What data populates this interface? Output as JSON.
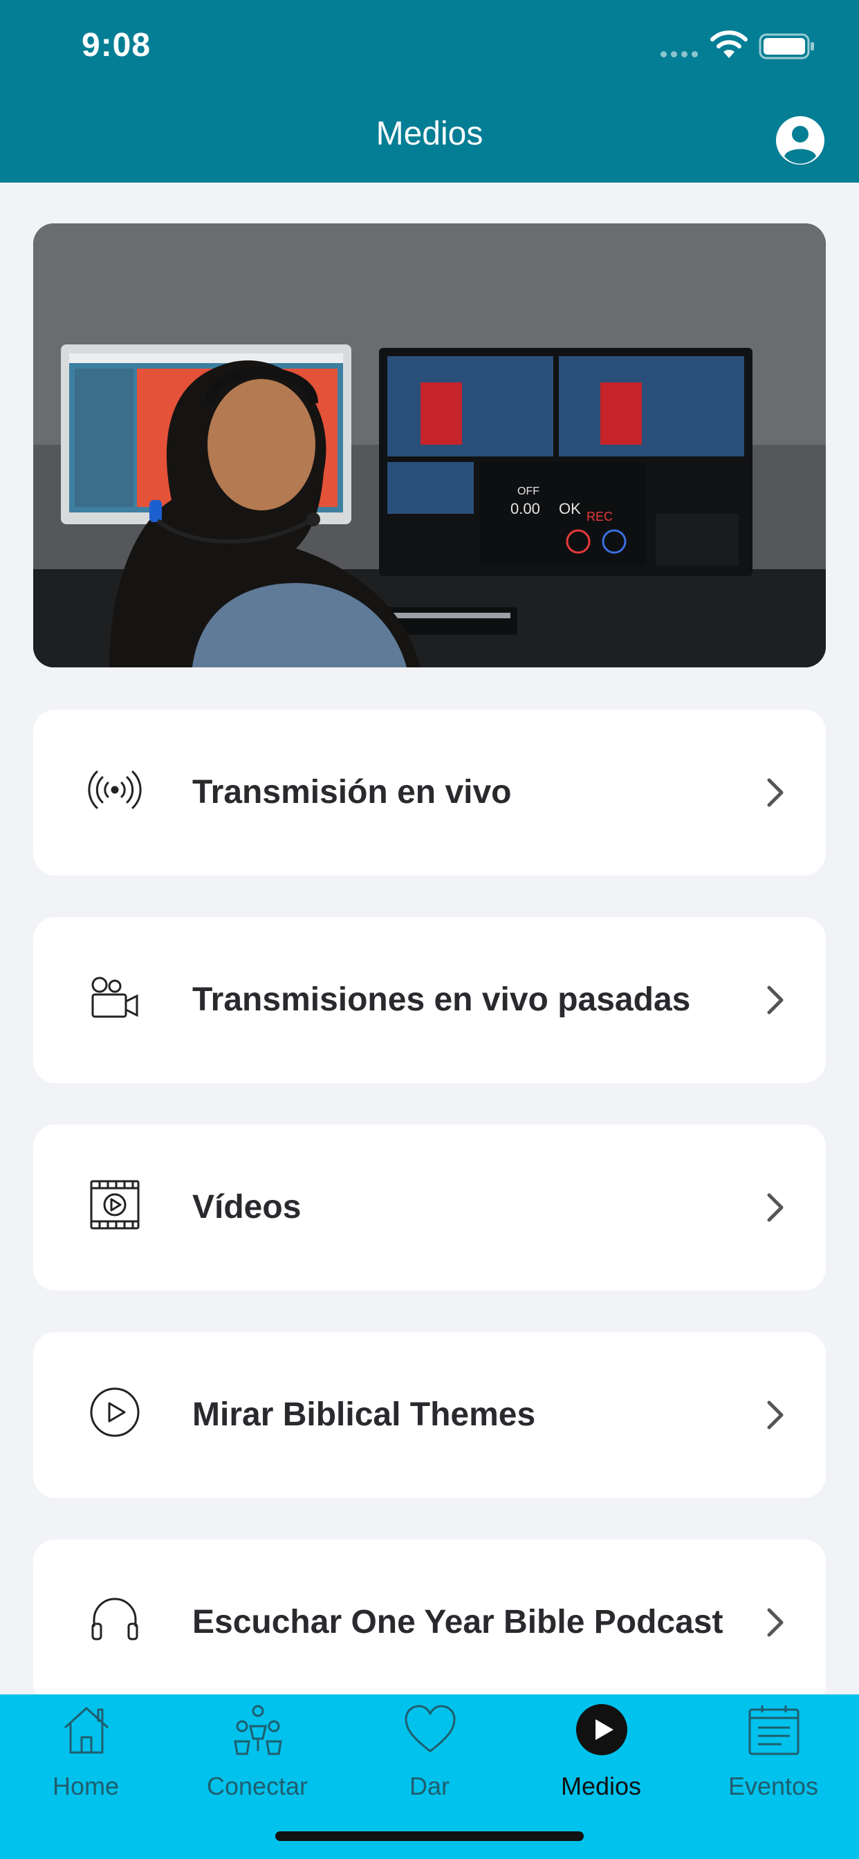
{
  "status_bar": {
    "time": "9:08"
  },
  "header": {
    "title": "Medios"
  },
  "menu": {
    "items": [
      {
        "label": "Transmisión en vivo",
        "icon": "broadcast-icon"
      },
      {
        "label": "Transmisiones en vivo pasadas",
        "icon": "video-camera-icon"
      },
      {
        "label": "Vídeos",
        "icon": "film-play-icon"
      },
      {
        "label": "Mirar Biblical Themes",
        "icon": "play-circle-icon"
      },
      {
        "label": "Escuchar One Year Bible Podcast",
        "icon": "headphones-icon"
      }
    ]
  },
  "tabbar": {
    "tabs": [
      {
        "label": "Home",
        "icon": "home-icon"
      },
      {
        "label": "Conectar",
        "icon": "people-icon"
      },
      {
        "label": "Dar",
        "icon": "heart-icon"
      },
      {
        "label": "Medios",
        "icon": "play-circle-filled-icon",
        "active": true
      },
      {
        "label": "Eventos",
        "icon": "calendar-icon"
      }
    ]
  },
  "colors": {
    "header_bg": "#047e94",
    "tabbar_bg": "#00c2ec",
    "page_bg": "#f2f3f7"
  }
}
